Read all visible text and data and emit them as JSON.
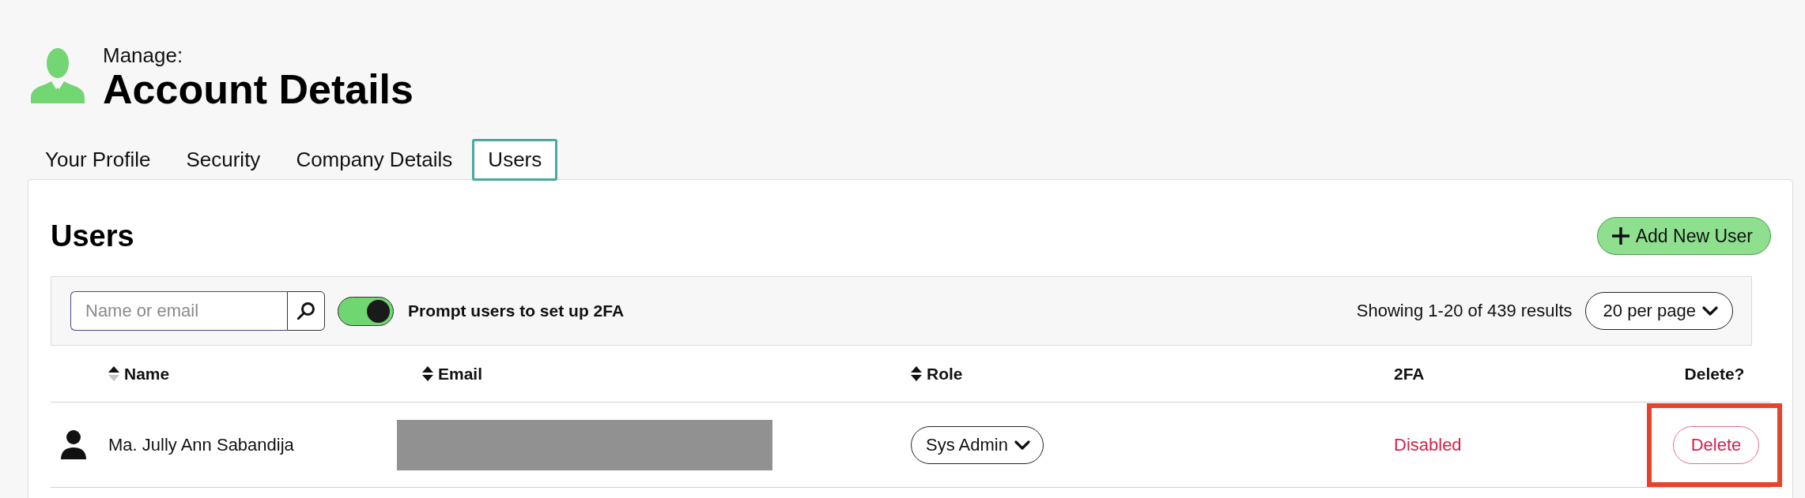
{
  "page_header": {
    "label": "Manage:",
    "title": "Account Details"
  },
  "tabs": [
    {
      "label": "Your Profile",
      "selected": false
    },
    {
      "label": "Security",
      "selected": false
    },
    {
      "label": "Company Details",
      "selected": false
    },
    {
      "label": "Users",
      "selected": true
    }
  ],
  "panel": {
    "title": "Users",
    "add_button": "Add New User"
  },
  "toolbar": {
    "search": {
      "placeholder": "Name or email"
    },
    "prompt_2fa": {
      "label": "Prompt users to set up 2FA",
      "on": true
    },
    "results_summary": "Showing 1-20 of 439 results",
    "page_size": "20 per page"
  },
  "table": {
    "columns": [
      {
        "label": "Name",
        "sortable": true,
        "sorted": true
      },
      {
        "label": "Email",
        "sortable": true,
        "sorted": false
      },
      {
        "label": "Role",
        "sortable": true,
        "sorted": false
      },
      {
        "label": "2FA",
        "sortable": false
      },
      {
        "label": "Delete?",
        "sortable": false
      }
    ],
    "rows": [
      {
        "name": "Ma. Jully Ann Sabandija",
        "email_redacted": true,
        "role": "Sys Admin",
        "two_fa": {
          "text": "Disabled",
          "enabled": false
        },
        "delete": {
          "label": "Delete",
          "highlighted": true
        }
      }
    ]
  }
}
